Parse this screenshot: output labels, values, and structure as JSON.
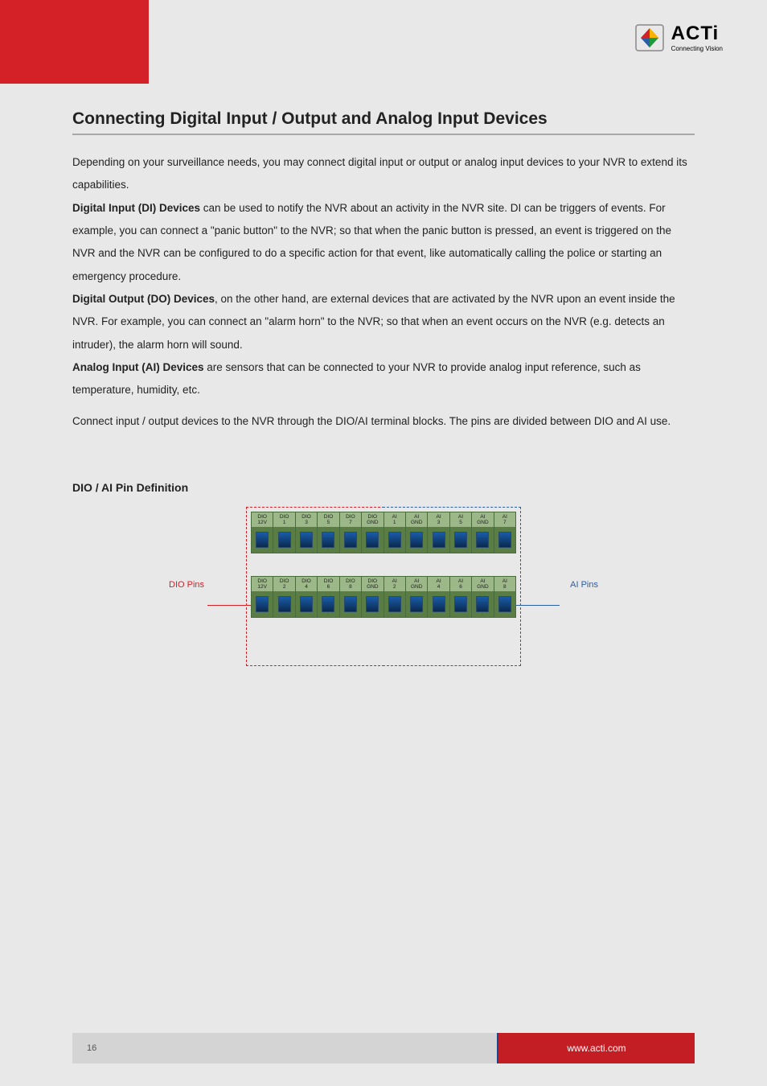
{
  "logo": {
    "main": "ACTi",
    "sub": "Connecting Vision"
  },
  "title": "Connecting Digital Input / Output and Analog Input Devices",
  "body": {
    "p1a": "Depending on your surveillance needs, you may connect digital input or output or analog input devices to your NVR to extend its capabilities.",
    "p1b_label": "Digital Input (DI) Devices",
    "p1b_text": " can be used to notify the NVR about an activity in the NVR site",
    "p1b_cont": ". DI can be triggers of events. For example, you can connect a \"panic button\" to the NVR; so that when the panic button is pressed, an event is triggered on the NVR and the NVR can be configured to do a specific action for that event, like automatically calling the police or starting an emergency procedure.",
    "p1c_label": "Digital Output (DO) Devices",
    "p1c_text": ", on the other hand, are external devices that are activated by the NVR upon an event inside the NVR",
    "p1c_cont": ". For example, you can connect an \"alarm horn\" to the NVR; so that when an event occurs on the NVR (e.g. detects an intruder), the alarm horn will sound.",
    "p1d_label": "Analog Input (AI) Devices",
    "p1d_text": " are sensors that can be connected to your NVR to provide analog input reference, such as temperature, humidity, etc.",
    "p2": "Connect input / output devices to the NVR through the DIO/AI terminal blocks. The pins are divided between DIO and AI use."
  },
  "subtitle": "DIO / AI Pin Definition",
  "side_left": "DIO Pins",
  "side_right": "AI Pins",
  "strip1": [
    "DIO\n12V",
    "DIO\n1",
    "DIO\n3",
    "DIO\n5",
    "DIO\n7",
    "DIO\nGND",
    "AI\n1",
    "AI\nGND",
    "AI\n3",
    "AI\n5",
    "AI\nGND",
    "AI\n7"
  ],
  "strip2": [
    "DIO\n12V",
    "DIO\n2",
    "DIO\n4",
    "DIO\n6",
    "DIO\n8",
    "DIO\nGND",
    "AI\n2",
    "AI\nGND",
    "AI\n4",
    "AI\n6",
    "AI\nGND",
    "AI\n8"
  ],
  "footer": {
    "page": "16",
    "site": "www.acti.com"
  }
}
